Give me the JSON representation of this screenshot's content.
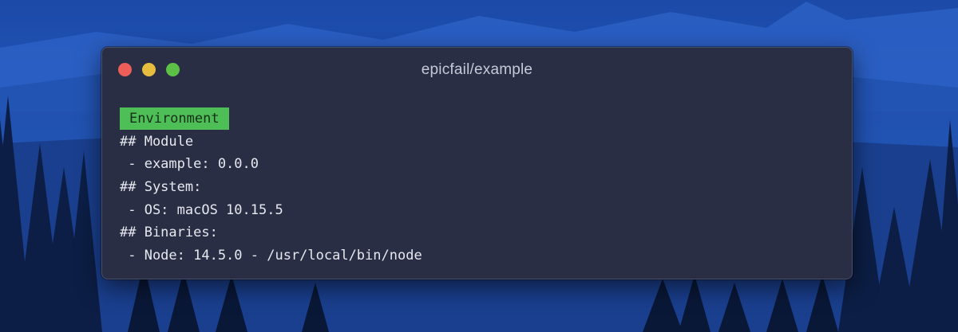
{
  "window": {
    "title": "epicfail/example"
  },
  "terminal": {
    "badge": "Environment",
    "lines": [
      "## Module",
      " - example: 0.0.0",
      "## System:",
      " - OS: macOS 10.15.5",
      "## Binaries:",
      " - Node: 14.5.0 - /usr/local/bin/node"
    ]
  },
  "colors": {
    "window_bg": "#2a2e45",
    "badge_bg": "#4ebe56",
    "close": "#ed5e58",
    "minimize": "#e6bd3f",
    "maximize": "#5cc146"
  }
}
